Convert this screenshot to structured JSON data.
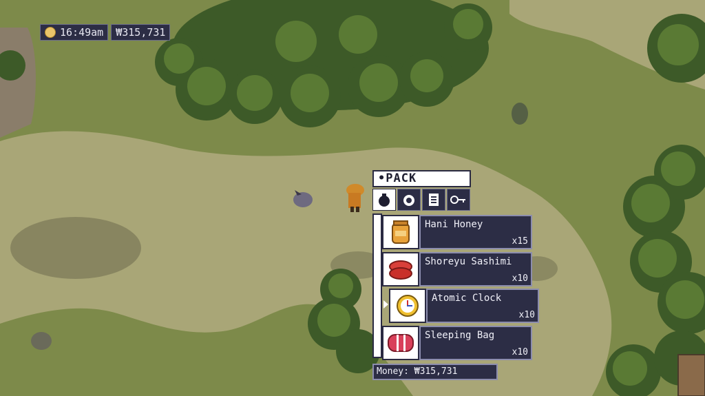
{
  "hud": {
    "time": "16:49am",
    "money": "₩315,731"
  },
  "pack": {
    "title": "•PACK",
    "tabs": [
      {
        "icon": "bag-icon",
        "active": true
      },
      {
        "icon": "food-icon",
        "active": false
      },
      {
        "icon": "document-icon",
        "active": false
      },
      {
        "icon": "key-icon",
        "active": false
      }
    ],
    "items": [
      {
        "name": "Hani Honey",
        "qty": "x15",
        "icon": "honey-jar-icon"
      },
      {
        "name": "Shoreyu Sashimi",
        "qty": "x10",
        "icon": "sashimi-icon"
      },
      {
        "name": "Atomic Clock",
        "qty": "x10",
        "icon": "clock-icon",
        "selected": true
      },
      {
        "name": "Sleeping Bag",
        "qty": "x10",
        "icon": "sleeping-bag-icon"
      }
    ],
    "money_label": "Money: ₩315,731"
  },
  "colors": {
    "panel_dark": "#2c2d45",
    "panel_light": "#ffffff",
    "grass": "#7d8a4a",
    "dirt": "#a9a677",
    "forest": "#3d5a28"
  }
}
